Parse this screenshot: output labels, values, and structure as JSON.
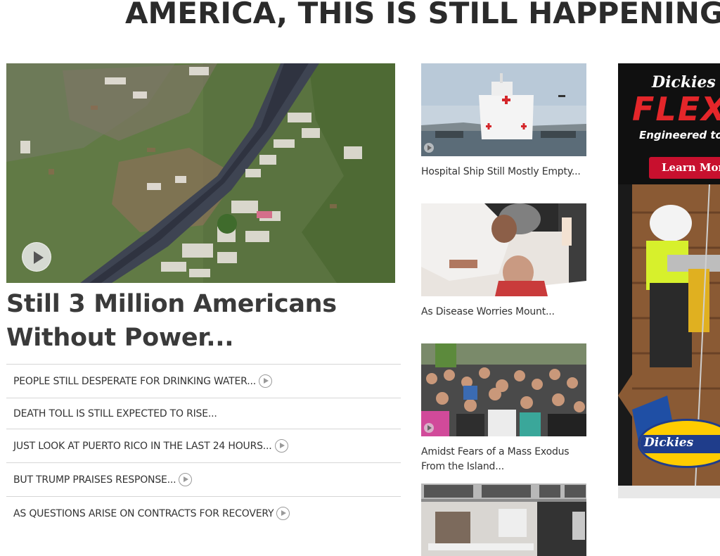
{
  "banner": {
    "headline": "AMERICA, THIS IS STILL HAPPENING"
  },
  "lead": {
    "title": "Still 3 Million Americans Without Power...",
    "image_alt": "aerial view of destroyed homes along a river"
  },
  "stories": [
    {
      "label": "PEOPLE STILL DESPERATE FOR DRINKING WATER...",
      "video": true
    },
    {
      "label": "DEATH TOLL IS STILL EXPECTED TO RISE...",
      "video": false
    },
    {
      "label": "JUST LOOK AT PUERTO RICO IN THE LAST 24 HOURS...",
      "video": true
    },
    {
      "label": "BUT TRUMP PRAISES RESPONSE...",
      "video": true
    },
    {
      "label": "AS QUESTIONS ARISE ON CONTRACTS FOR RECOVERY",
      "video": true
    }
  ],
  "side_stories": [
    {
      "caption": "Hospital Ship Still Mostly Empty...",
      "video": true
    },
    {
      "caption": "As Disease Worries Mount...",
      "video": false
    },
    {
      "caption": "Amidst Fears of a Mass Exodus From the Island...",
      "video": true
    },
    {
      "caption": "",
      "video": false
    }
  ],
  "ad": {
    "brand": "Dickies",
    "product": "FLEX",
    "tagline": "Engineered to Move",
    "cta": "Learn More",
    "logo_text": "Dickies",
    "colors": {
      "accent": "#e4262a",
      "cta": "#c8102e",
      "logo_blue": "#1f3d8b",
      "logo_yellow": "#ffcc00"
    }
  },
  "icons": {
    "video_play": "play-circle-icon"
  }
}
